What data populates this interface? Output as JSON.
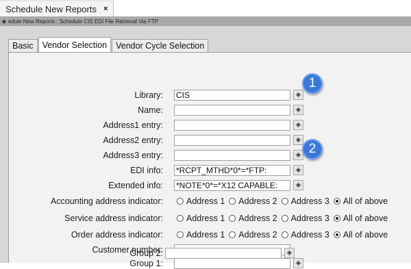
{
  "window_tab": {
    "title": "Schedule New Reports",
    "close": "×"
  },
  "breadcrumb": {
    "icon": "◈",
    "text": "edule New Reports : Schedule CIS EDI File Retrieval Via FTP"
  },
  "tabs": [
    {
      "label": "Basic"
    },
    {
      "label": "Vendor Selection"
    },
    {
      "label": "Vendor Cycle Selection"
    }
  ],
  "lookup_glyph": "◈",
  "fields": {
    "library": {
      "label": "Library:",
      "value": "CIS"
    },
    "name": {
      "label": "Name:",
      "value": ""
    },
    "address1": {
      "label": "Address1 entry:",
      "value": ""
    },
    "address2": {
      "label": "Address2 entry:",
      "value": ""
    },
    "address3": {
      "label": "Address3 entry:",
      "value": ""
    },
    "edi_info": {
      "label": "EDI info:",
      "value": "*RCPT_MTHD*0*=*FTP:"
    },
    "extended_info": {
      "label": "Extended info:",
      "value": "*NOTE*0*=*X12 CAPABLE:"
    },
    "customer_number": {
      "label": "Customer number:",
      "value": ""
    },
    "group1": {
      "label": "Group 1:",
      "value": ""
    },
    "group2": {
      "label": "Group 2:",
      "value": ""
    }
  },
  "address_indicators": {
    "accounting": {
      "label": "Accounting address indicator:"
    },
    "service": {
      "label": "Service address indicator:"
    },
    "order": {
      "label": "Order address indicator:"
    },
    "options": [
      "Address 1",
      "Address 2",
      "Address 3",
      "All of above"
    ],
    "selected": "All of above"
  },
  "callouts": [
    "1",
    "2"
  ]
}
